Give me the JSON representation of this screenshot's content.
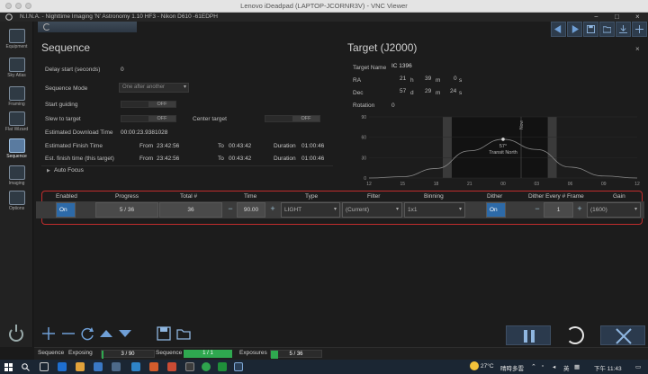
{
  "vnc": {
    "title": "Lenovo iDeadpad (LAPTOP-JCORNR3V) - VNC Viewer"
  },
  "app": {
    "title": "N.I.N.A. - Nighttime Imaging 'N' Astronomy 1.10 HF3   -   Nikon D610 -61EDPH",
    "minimize": "−",
    "maximize": "□",
    "close": "×"
  },
  "sidebar": {
    "items": [
      {
        "label": "Equipment",
        "icon": "camera-icon"
      },
      {
        "label": "Sky Atlas",
        "icon": "sky-atlas-icon"
      },
      {
        "label": "Framing",
        "icon": "framing-icon"
      },
      {
        "label": "Flat Wizard",
        "icon": "flat-wizard-icon"
      },
      {
        "label": "Sequence",
        "icon": "sequence-icon"
      },
      {
        "label": "Imaging",
        "icon": "imaging-icon"
      },
      {
        "label": "Options",
        "icon": "options-icon"
      }
    ]
  },
  "sequence": {
    "title": "Sequence",
    "delay_label": "Delay start (seconds)",
    "delay_value": "0",
    "mode_label": "Sequence Mode",
    "mode_value": "One after another",
    "start_guiding_label": "Start guiding",
    "start_guiding_value": "OFF",
    "slew_label": "Slew to target",
    "slew_value": "OFF",
    "center_label": "Center target",
    "center_value": "OFF",
    "download_label": "Estimated Download Time",
    "download_value": "00:00:23.9381028",
    "finish_label": "Estimated Finish Time",
    "finish_target_label": "Est. finish time (this target)",
    "from_label": "From",
    "to_label": "To",
    "duration_label": "Duration",
    "finish_from": "23:42:56",
    "finish_to": "00:43:42",
    "finish_duration": "01:00:46",
    "target_from": "23:42:56",
    "target_to": "00:43:42",
    "target_duration": "01:00:46",
    "autofocus_label": "Auto Focus"
  },
  "target": {
    "title": "Target (J2000)",
    "name_label": "Target Name",
    "name_value": "IC 1396",
    "ra_label": "RA",
    "ra_h": "21",
    "ra_h_unit": "h",
    "ra_m": "39",
    "ra_m_unit": "m",
    "ra_s": "0",
    "ra_s_unit": "s",
    "dec_label": "Dec",
    "dec_d": "57",
    "dec_d_unit": "d",
    "dec_m": "29",
    "dec_m_unit": "m",
    "dec_s": "24",
    "dec_s_unit": "s",
    "rotation_label": "Rotation",
    "rotation_value": "0"
  },
  "chart_data": {
    "type": "area",
    "title": "",
    "xlabel": "",
    "ylabel": "",
    "x_ticks": [
      "12",
      "15",
      "18",
      "21",
      "00",
      "03",
      "06",
      "09",
      "12"
    ],
    "y_ticks": [
      "90",
      "60",
      "30",
      "0"
    ],
    "ylim": [
      0,
      90
    ],
    "series": [
      {
        "values": [
          0,
          2,
          14,
          40,
          57,
          42,
          16,
          3,
          0
        ]
      }
    ],
    "annotations": {
      "peak_label": "57°",
      "transit_label": "Transit North",
      "now_label": "Now"
    }
  },
  "table": {
    "headers": [
      "Enabled",
      "Progress",
      "Total #",
      "Time",
      "Type",
      "Filter",
      "Binning",
      "Dither",
      "Dither Every # Frame",
      "Gain"
    ],
    "row": {
      "enabled": "On",
      "progress": "5 / 36",
      "total": "36",
      "time": "90.00",
      "type": "LIGHT",
      "filter": "(Current)",
      "binning": "1x1",
      "dither": "On",
      "dither_every": "1",
      "gain": "(1600)"
    }
  },
  "status": {
    "sequence_label": "Sequence",
    "exposing_label": "Exposing",
    "exposing_value": "3 / 90",
    "sequence2_label": "Sequence",
    "sequence2_value": "1 / 1",
    "exposures_label": "Exposures",
    "exposures_value": "5 / 36"
  },
  "taskbar": {
    "weather": "27°C",
    "weather_text": "晴時多雲",
    "ime": "英",
    "time": "下午 11:43"
  },
  "colors": {
    "accent": "#2d6aa8",
    "highlight": "#c22d2d",
    "green": "#2fa84f"
  }
}
